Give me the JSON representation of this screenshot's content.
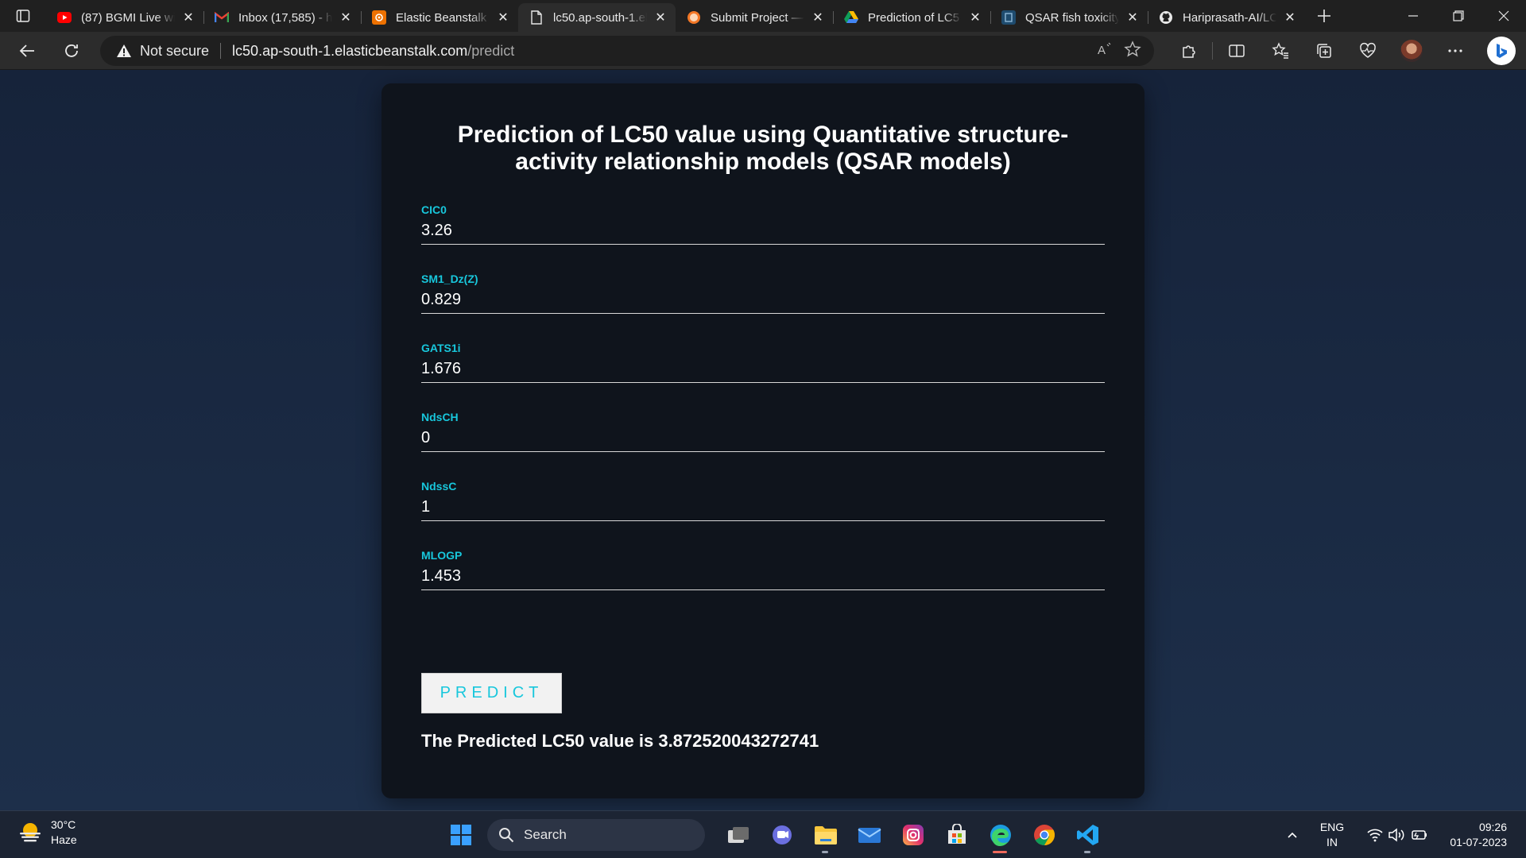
{
  "browser": {
    "tabs": [
      {
        "title": "(87) BGMI Live wi",
        "icon": "youtube-icon"
      },
      {
        "title": "Inbox (17,585) - h",
        "icon": "gmail-icon"
      },
      {
        "title": "Elastic Beanstalk",
        "icon": "aws-icon"
      },
      {
        "title": "lc50.ap-south-1.el",
        "icon": "page-icon",
        "active": true
      },
      {
        "title": "Submit Project —",
        "icon": "jupyter-icon"
      },
      {
        "title": "Prediction of LC5",
        "icon": "drive-icon"
      },
      {
        "title": "QSAR fish toxicity",
        "icon": "uci-icon"
      },
      {
        "title": "Hariprasath-AI/LC",
        "icon": "github-icon"
      }
    ],
    "address": {
      "security_label": "Not secure",
      "host": "lc50.ap-south-1.elasticbeanstalk.com",
      "path": "/predict"
    }
  },
  "form": {
    "title": "Prediction of LC50 value using Quantitative structure-activity relationship models (QSAR models)",
    "fields": [
      {
        "label": "CIC0",
        "value": "3.26"
      },
      {
        "label": "SM1_Dz(Z)",
        "value": "0.829"
      },
      {
        "label": "GATS1i",
        "value": "1.676"
      },
      {
        "label": "NdsCH",
        "value": "0"
      },
      {
        "label": "NdssC",
        "value": "1"
      },
      {
        "label": "MLOGP",
        "value": "1.453"
      }
    ],
    "predict_label": "PREDICT",
    "result_text": "The Predicted LC50 value is 3.872520043272741"
  },
  "taskbar": {
    "weather_temp": "30°C",
    "weather_desc": "Haze",
    "search_placeholder": "Search",
    "lang_top": "ENG",
    "lang_bottom": "IN",
    "time": "09:26",
    "date": "01-07-2023"
  },
  "colors": {
    "accent": "#18c7dc",
    "card_bg": "#0f141c",
    "page_bg": "#1b2a3f"
  }
}
